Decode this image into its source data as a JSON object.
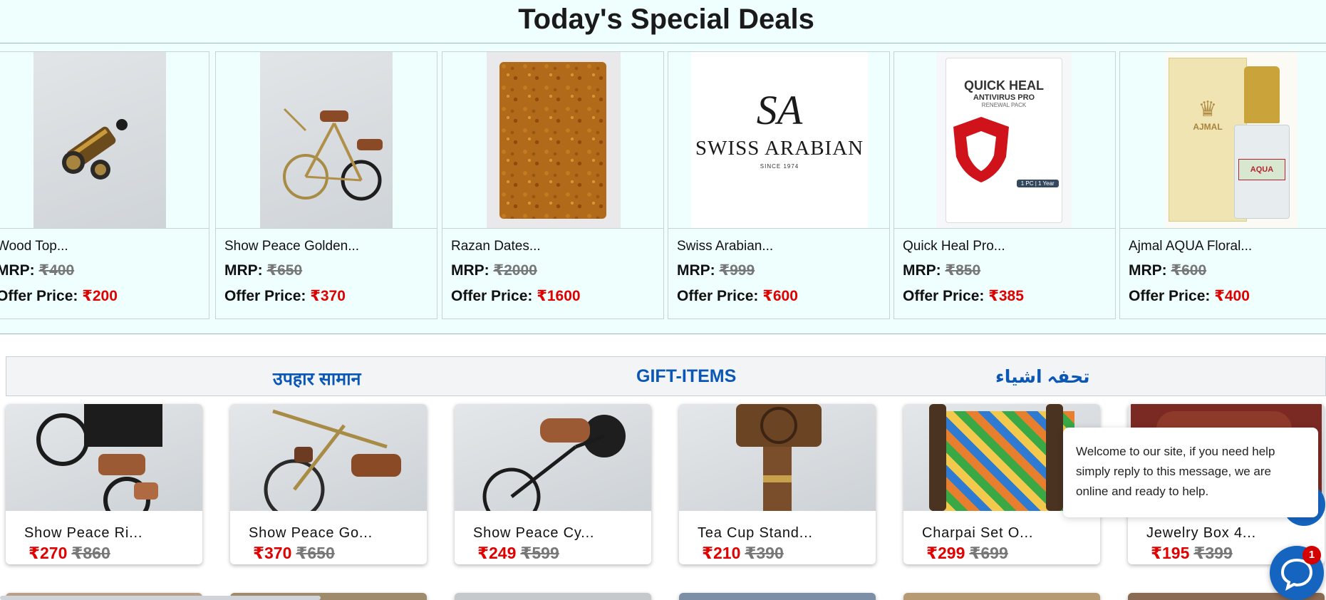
{
  "deals": {
    "title": "Today's Special Deals",
    "items": [
      {
        "name": "Wood Top...",
        "mrp_label": "MRP:",
        "mrp": "₹400",
        "offer_label": "Offer Price:",
        "offer": "₹200"
      },
      {
        "name": "Show Peace Golden...",
        "mrp_label": "MRP:",
        "mrp": "₹650",
        "offer_label": "Offer Price:",
        "offer": "₹370"
      },
      {
        "name": "Razan Dates...",
        "mrp_label": "MRP:",
        "mrp": "₹2000",
        "offer_label": "Offer Price:",
        "offer": "₹1600"
      },
      {
        "name": "Swiss Arabian...",
        "mrp_label": "MRP:",
        "mrp": "₹999",
        "offer_label": "Offer Price:",
        "offer": "₹600"
      },
      {
        "name": "Quick Heal Pro...",
        "mrp_label": "MRP:",
        "mrp": "₹850",
        "offer_label": "Offer Price:",
        "offer": "₹385"
      },
      {
        "name": "Ajmal AQUA Floral...",
        "mrp_label": "MRP:",
        "mrp": "₹600",
        "offer_label": "Offer Price:",
        "offer": "₹400"
      }
    ]
  },
  "logos": {
    "swiss_arabian": {
      "monogram": "SA",
      "brand": "SWISS ARABIAN",
      "since": "SINCE 1974"
    },
    "quick_heal": {
      "line1": "QUICK HEAL",
      "line2": "ANTIVIRUS PRO",
      "line3": "RENEWAL PACK",
      "tag": "1 PC | 1 Year"
    },
    "ajmal": {
      "brand": "AJMAL",
      "product": "AQUA"
    }
  },
  "gift_bar": {
    "hindi": "उपहार सामान",
    "english": "GIFT-ITEMS",
    "urdu": "تحفہ اشیاء"
  },
  "gift_items": [
    {
      "name": "Show Peace Ri...",
      "price": "₹270",
      "was": "₹860"
    },
    {
      "name": "Show Peace Go...",
      "price": "₹370",
      "was": "₹650"
    },
    {
      "name": "Show Peace Cy...",
      "price": "₹249",
      "was": "₹599"
    },
    {
      "name": "Tea Cup Stand...",
      "price": "₹210",
      "was": "₹390"
    },
    {
      "name": "Charpai Set O...",
      "price": "₹299",
      "was": "₹699"
    },
    {
      "name": "Jewelry Box 4...",
      "price": "₹195",
      "was": "₹399"
    }
  ],
  "chat": {
    "message": "Welcome to our site, if you need help simply reply to this message, we are online and ready to help.",
    "badge_count": "1",
    "icon": "chat-icon"
  },
  "colors": {
    "accent_red": "#e00000",
    "gift_blue": "#0b57b5",
    "deals_bg": "#effffe",
    "chat_blue": "#1565c0"
  }
}
